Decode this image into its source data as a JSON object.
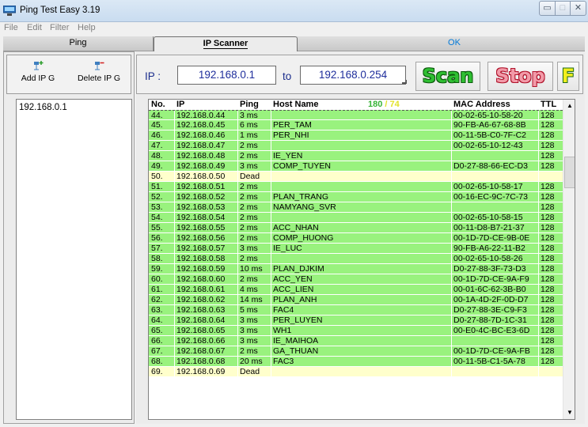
{
  "window": {
    "title": "Ping Test Easy 3.19",
    "min_symbol": "▭",
    "max_symbol": "□",
    "close_symbol": "✕"
  },
  "menu": [
    "File",
    "Edit",
    "Filter",
    "Help"
  ],
  "tabs": {
    "ping": "Ping",
    "ip_scanner": "IP Scanner",
    "status": "OK"
  },
  "left": {
    "add_label": "Add IP G",
    "delete_label": "Delete IP G",
    "list": [
      "192.168.0.1"
    ]
  },
  "range": {
    "ip_label": "IP :",
    "from": "192.168.0.1",
    "to_label": "to",
    "to": "192.168.0.254",
    "scan": "Scan",
    "stop": "Stop",
    "f": "F"
  },
  "table": {
    "headers": {
      "no": "No.",
      "ip": "IP",
      "ping": "Ping",
      "host": "Host Name",
      "count_alive": "180",
      "count_sep": " / ",
      "count_dead": "74",
      "mac": "MAC Address",
      "ttl": "TTL"
    },
    "rows": [
      {
        "no": "44.",
        "ip": "192.168.0.44",
        "ping": "3 ms",
        "host": "",
        "mac": "00-02-65-10-58-20",
        "ttl": "128",
        "dead": false
      },
      {
        "no": "45.",
        "ip": "192.168.0.45",
        "ping": "6 ms",
        "host": "PER_TAM",
        "mac": "90-FB-A6-67-68-8B",
        "ttl": "128",
        "dead": false
      },
      {
        "no": "46.",
        "ip": "192.168.0.46",
        "ping": "1 ms",
        "host": "PER_NHI",
        "mac": "00-11-5B-C0-7F-C2",
        "ttl": "128",
        "dead": false
      },
      {
        "no": "47.",
        "ip": "192.168.0.47",
        "ping": "2 ms",
        "host": "",
        "mac": "00-02-65-10-12-43",
        "ttl": "128",
        "dead": false
      },
      {
        "no": "48.",
        "ip": "192.168.0.48",
        "ping": "2 ms",
        "host": "IE_YEN",
        "mac": "",
        "ttl": "128",
        "dead": false
      },
      {
        "no": "49.",
        "ip": "192.168.0.49",
        "ping": "3 ms",
        "host": "COMP_TUYEN",
        "mac": "D0-27-88-66-EC-D3",
        "ttl": "128",
        "dead": false
      },
      {
        "no": "50.",
        "ip": "192.168.0.50",
        "ping": "Dead",
        "host": "",
        "mac": "",
        "ttl": "",
        "dead": true
      },
      {
        "no": "51.",
        "ip": "192.168.0.51",
        "ping": "2 ms",
        "host": "",
        "mac": "00-02-65-10-58-17",
        "ttl": "128",
        "dead": false
      },
      {
        "no": "52.",
        "ip": "192.168.0.52",
        "ping": "2 ms",
        "host": "PLAN_TRANG",
        "mac": "00-16-EC-9C-7C-73",
        "ttl": "128",
        "dead": false
      },
      {
        "no": "53.",
        "ip": "192.168.0.53",
        "ping": "2 ms",
        "host": "NAMYANG_SVR",
        "mac": "",
        "ttl": "128",
        "dead": false
      },
      {
        "no": "54.",
        "ip": "192.168.0.54",
        "ping": "2 ms",
        "host": "",
        "mac": "00-02-65-10-58-15",
        "ttl": "128",
        "dead": false
      },
      {
        "no": "55.",
        "ip": "192.168.0.55",
        "ping": "2 ms",
        "host": "ACC_NHAN",
        "mac": "00-11-D8-B7-21-37",
        "ttl": "128",
        "dead": false
      },
      {
        "no": "56.",
        "ip": "192.168.0.56",
        "ping": "2 ms",
        "host": "COMP_HUONG",
        "mac": "00-1D-7D-CE-9B-0E",
        "ttl": "128",
        "dead": false
      },
      {
        "no": "57.",
        "ip": "192.168.0.57",
        "ping": "3 ms",
        "host": "IE_LUC",
        "mac": "90-FB-A6-22-11-B2",
        "ttl": "128",
        "dead": false
      },
      {
        "no": "58.",
        "ip": "192.168.0.58",
        "ping": "2 ms",
        "host": "",
        "mac": "00-02-65-10-58-26",
        "ttl": "128",
        "dead": false
      },
      {
        "no": "59.",
        "ip": "192.168.0.59",
        "ping": "10 ms",
        "host": "PLAN_DJKIM",
        "mac": "D0-27-88-3F-73-D3",
        "ttl": "128",
        "dead": false
      },
      {
        "no": "60.",
        "ip": "192.168.0.60",
        "ping": "2 ms",
        "host": "ACC_YEN",
        "mac": "00-1D-7D-CE-9A-F9",
        "ttl": "128",
        "dead": false
      },
      {
        "no": "61.",
        "ip": "192.168.0.61",
        "ping": "4 ms",
        "host": "ACC_LIEN",
        "mac": "00-01-6C-62-3B-B0",
        "ttl": "128",
        "dead": false
      },
      {
        "no": "62.",
        "ip": "192.168.0.62",
        "ping": "14 ms",
        "host": "PLAN_ANH",
        "mac": "00-1A-4D-2F-0D-D7",
        "ttl": "128",
        "dead": false
      },
      {
        "no": "63.",
        "ip": "192.168.0.63",
        "ping": "5 ms",
        "host": "FAC4",
        "mac": "D0-27-88-3E-C9-F3",
        "ttl": "128",
        "dead": false
      },
      {
        "no": "64.",
        "ip": "192.168.0.64",
        "ping": "3 ms",
        "host": "PER_LUYEN",
        "mac": "D0-27-88-7D-1C-31",
        "ttl": "128",
        "dead": false
      },
      {
        "no": "65.",
        "ip": "192.168.0.65",
        "ping": "3 ms",
        "host": "WH1",
        "mac": "00-E0-4C-BC-E3-6D",
        "ttl": "128",
        "dead": false
      },
      {
        "no": "66.",
        "ip": "192.168.0.66",
        "ping": "3 ms",
        "host": "IE_MAIHOA",
        "mac": "",
        "ttl": "128",
        "dead": false
      },
      {
        "no": "67.",
        "ip": "192.168.0.67",
        "ping": "2 ms",
        "host": "GA_THUAN",
        "mac": "00-1D-7D-CE-9A-FB",
        "ttl": "128",
        "dead": false
      },
      {
        "no": "68.",
        "ip": "192.168.0.68",
        "ping": "20 ms",
        "host": "FAC3",
        "mac": "00-11-5B-C1-5A-78",
        "ttl": "128",
        "dead": false
      },
      {
        "no": "69.",
        "ip": "192.168.0.69",
        "ping": "Dead",
        "host": "",
        "mac": "",
        "ttl": "",
        "dead": true
      }
    ]
  },
  "colors": {
    "alive_row": "#99f27e",
    "dead_row": "#ffffcc",
    "scan": "#2fbf32",
    "stop": "#f29aa8",
    "status_ok": "#0078d7"
  },
  "scrollbar": {
    "up_symbol": "▲",
    "down_symbol": "▼",
    "position_fraction": 0.17
  }
}
